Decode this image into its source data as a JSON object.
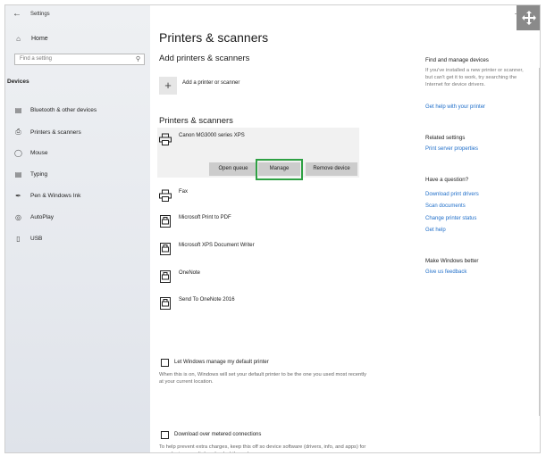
{
  "window": {
    "title": "Settings"
  },
  "sidebar": {
    "home": "Home",
    "search_placeholder": "Find a setting",
    "section": "Devices",
    "items": [
      {
        "label": "Bluetooth & other devices",
        "icon": "keyboard-icon"
      },
      {
        "label": "Printers & scanners",
        "icon": "printer-icon"
      },
      {
        "label": "Mouse",
        "icon": "mouse-icon"
      },
      {
        "label": "Typing",
        "icon": "keyboard-icon"
      },
      {
        "label": "Pen & Windows Ink",
        "icon": "pen-icon"
      },
      {
        "label": "AutoPlay",
        "icon": "autoplay-icon"
      },
      {
        "label": "USB",
        "icon": "usb-icon"
      }
    ]
  },
  "main": {
    "title": "Printers & scanners",
    "add_heading": "Add printers & scanners",
    "add_label": "Add a printer or scanner",
    "list_heading": "Printers & scanners",
    "selected_printer": "Canon MG3000 series XPS",
    "actions": {
      "open_queue": "Open queue",
      "manage": "Manage",
      "remove": "Remove device"
    },
    "printers": [
      "Fax",
      "Microsoft Print to PDF",
      "Microsoft XPS Document Writer",
      "OneNote",
      "Send To OneNote 2016"
    ],
    "default_checkbox": "Let Windows manage my default printer",
    "default_help": "When this is on, Windows will set your default printer to be the one you used most recently at your current location.",
    "metered_checkbox": "Download over metered connections",
    "metered_help": "To help prevent extra charges, keep this off so device software (drivers, info, and apps) for new devices won't download while you're on"
  },
  "right": {
    "find_heading": "Find and manage devices",
    "find_text": "If you've installed a new printer or scanner, but can't get it to work, try searching the Internet for device drivers.",
    "help_link": "Get help with your printer",
    "related_heading": "Related settings",
    "print_server": "Print server properties",
    "question_heading": "Have a question?",
    "links": [
      "Download print drivers",
      "Scan documents",
      "Change printer status",
      "Get help"
    ],
    "better_heading": "Make Windows better",
    "feedback": "Give us feedback"
  },
  "colors": {
    "accent": "#1f6ec9",
    "highlight": "#2ea043"
  }
}
